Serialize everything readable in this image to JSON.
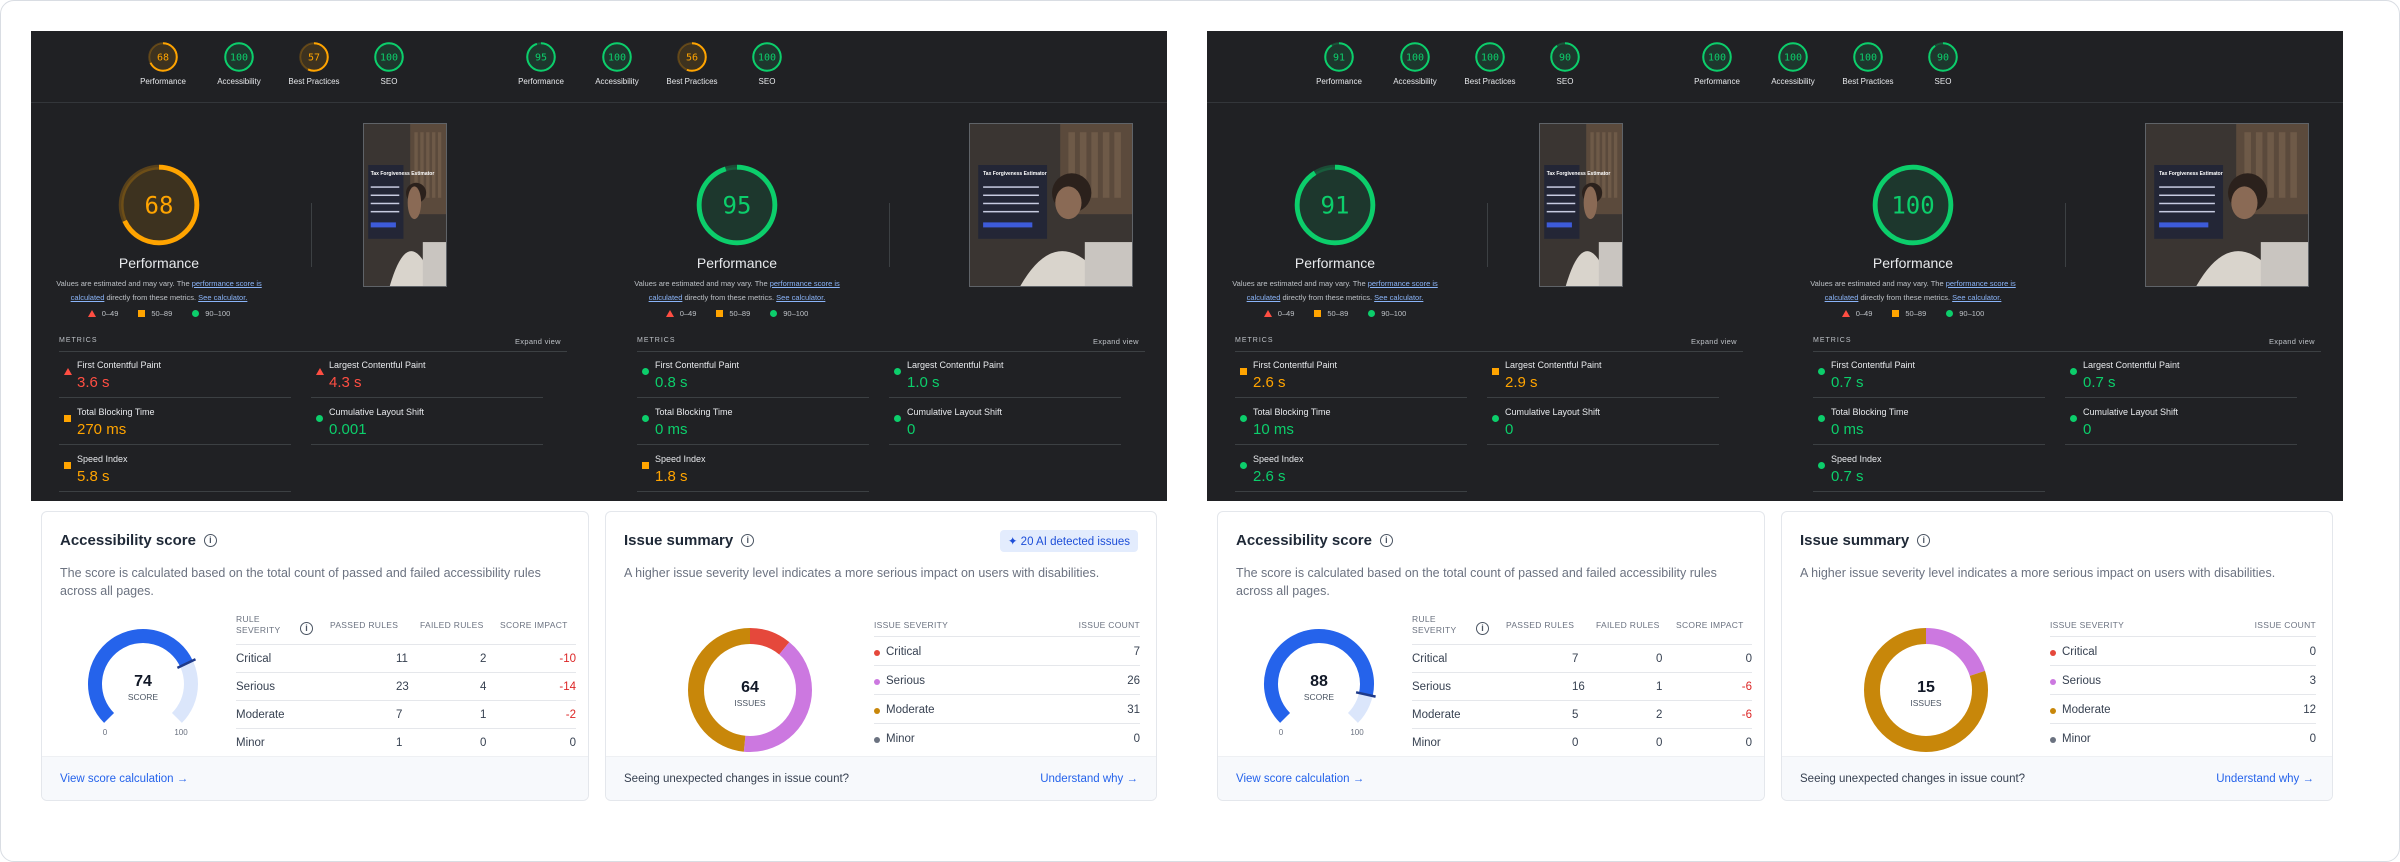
{
  "panels": [
    {
      "cats": [
        {
          "label": "Performance",
          "score": "68",
          "value": 68,
          "color": "#ffa400"
        },
        {
          "label": "Accessibility",
          "score": "100",
          "value": 100,
          "color": "#0cce6b"
        },
        {
          "label": "Best Practices",
          "score": "57",
          "value": 57,
          "color": "#ffa400"
        },
        {
          "label": "SEO",
          "score": "100",
          "value": 100,
          "color": "#0cce6b"
        },
        {
          "label": "Performance",
          "score": "95",
          "value": 95,
          "color": "#0cce6b"
        },
        {
          "label": "Accessibility",
          "score": "100",
          "value": 100,
          "color": "#0cce6b"
        },
        {
          "label": "Best Practices",
          "score": "56",
          "value": 56,
          "color": "#ffa400"
        },
        {
          "label": "SEO",
          "score": "100",
          "value": 100,
          "color": "#0cce6b"
        }
      ],
      "perf": [
        {
          "score": "68",
          "value": 68,
          "color": "#ffa400",
          "title": "Performance",
          "metrics": [
            {
              "name": "First Contentful Paint",
              "value": "3.6 s",
              "level": "red"
            },
            {
              "name": "Largest Contentful Paint",
              "value": "4.3 s",
              "level": "red"
            },
            {
              "name": "Total Blocking Time",
              "value": "270 ms",
              "level": "orange"
            },
            {
              "name": "Cumulative Layout Shift",
              "value": "0.001",
              "level": "green"
            },
            {
              "name": "Speed Index",
              "value": "5.8 s",
              "level": "orange"
            }
          ]
        },
        {
          "score": "95",
          "value": 95,
          "color": "#0cce6b",
          "title": "Performance",
          "metrics": [
            {
              "name": "First Contentful Paint",
              "value": "0.8 s",
              "level": "green"
            },
            {
              "name": "Largest Contentful Paint",
              "value": "1.0 s",
              "level": "green"
            },
            {
              "name": "Total Blocking Time",
              "value": "0 ms",
              "level": "green"
            },
            {
              "name": "Cumulative Layout Shift",
              "value": "0",
              "level": "green"
            },
            {
              "name": "Speed Index",
              "value": "1.8 s",
              "level": "orange"
            }
          ]
        }
      ],
      "accessibility": {
        "score": "74",
        "value": 74,
        "rows": [
          {
            "sev": "Critical",
            "passed": "11",
            "failed": "2",
            "impact": "-10"
          },
          {
            "sev": "Serious",
            "passed": "23",
            "failed": "4",
            "impact": "-14"
          },
          {
            "sev": "Moderate",
            "passed": "7",
            "failed": "1",
            "impact": "-2"
          },
          {
            "sev": "Minor",
            "passed": "1",
            "failed": "0",
            "impact": "0"
          }
        ]
      },
      "issues": {
        "total": "64",
        "ai_badge": "20 AI detected issues",
        "rows": [
          {
            "sev": "Critical",
            "count": "7",
            "value": 7,
            "color": "#e5483b"
          },
          {
            "sev": "Serious",
            "count": "26",
            "value": 26,
            "color": "#cc78e0"
          },
          {
            "sev": "Moderate",
            "count": "31",
            "value": 31,
            "color": "#c8870a"
          },
          {
            "sev": "Minor",
            "count": "0",
            "value": 0,
            "color": "#6b7280"
          }
        ]
      }
    },
    {
      "cats": [
        {
          "label": "Performance",
          "score": "91",
          "value": 91,
          "color": "#0cce6b"
        },
        {
          "label": "Accessibility",
          "score": "100",
          "value": 100,
          "color": "#0cce6b"
        },
        {
          "label": "Best Practices",
          "score": "100",
          "value": 100,
          "color": "#0cce6b"
        },
        {
          "label": "SEO",
          "score": "90",
          "value": 90,
          "color": "#0cce6b"
        },
        {
          "label": "Performance",
          "score": "100",
          "value": 100,
          "color": "#0cce6b"
        },
        {
          "label": "Accessibility",
          "score": "100",
          "value": 100,
          "color": "#0cce6b"
        },
        {
          "label": "Best Practices",
          "score": "100",
          "value": 100,
          "color": "#0cce6b"
        },
        {
          "label": "SEO",
          "score": "90",
          "value": 90,
          "color": "#0cce6b"
        }
      ],
      "perf": [
        {
          "score": "91",
          "value": 91,
          "color": "#0cce6b",
          "title": "Performance",
          "metrics": [
            {
              "name": "First Contentful Paint",
              "value": "2.6 s",
              "level": "orange"
            },
            {
              "name": "Largest Contentful Paint",
              "value": "2.9 s",
              "level": "orange"
            },
            {
              "name": "Total Blocking Time",
              "value": "10 ms",
              "level": "green"
            },
            {
              "name": "Cumulative Layout Shift",
              "value": "0",
              "level": "green"
            },
            {
              "name": "Speed Index",
              "value": "2.6 s",
              "level": "green"
            }
          ]
        },
        {
          "score": "100",
          "value": 100,
          "color": "#0cce6b",
          "title": "Performance",
          "metrics": [
            {
              "name": "First Contentful Paint",
              "value": "0.7 s",
              "level": "green"
            },
            {
              "name": "Largest Contentful Paint",
              "value": "0.7 s",
              "level": "green"
            },
            {
              "name": "Total Blocking Time",
              "value": "0 ms",
              "level": "green"
            },
            {
              "name": "Cumulative Layout Shift",
              "value": "0",
              "level": "green"
            },
            {
              "name": "Speed Index",
              "value": "0.7 s",
              "level": "green"
            }
          ]
        }
      ],
      "accessibility": {
        "score": "88",
        "value": 88,
        "rows": [
          {
            "sev": "Critical",
            "passed": "7",
            "failed": "0",
            "impact": "0"
          },
          {
            "sev": "Serious",
            "passed": "16",
            "failed": "1",
            "impact": "-6"
          },
          {
            "sev": "Moderate",
            "passed": "5",
            "failed": "2",
            "impact": "-6"
          },
          {
            "sev": "Minor",
            "passed": "0",
            "failed": "0",
            "impact": "0"
          }
        ]
      },
      "issues": {
        "total": "15",
        "ai_badge": "",
        "rows": [
          {
            "sev": "Critical",
            "count": "0",
            "value": 0,
            "color": "#e5483b"
          },
          {
            "sev": "Serious",
            "count": "3",
            "value": 3,
            "color": "#cc78e0"
          },
          {
            "sev": "Moderate",
            "count": "12",
            "value": 12,
            "color": "#c8870a"
          },
          {
            "sev": "Minor",
            "count": "0",
            "value": 0,
            "color": "#6b7280"
          }
        ]
      }
    }
  ],
  "text": {
    "note_a": "Values are estimated and may vary. The ",
    "note_link1": "performance score is calculated",
    "note_b": " directly from these metrics. ",
    "note_link2": "See calculator.",
    "legend_bad": "0–49",
    "legend_avg": "50–89",
    "legend_good": "90–100",
    "metrics": "METRICS",
    "expand": "Expand view",
    "shot_title": "Tax Forgiveness Estimator",
    "acc_title": "Accessibility score",
    "acc_desc": "The score is calculated based on the total count of passed and failed accessibility rules across all pages.",
    "score_label": "SCORE",
    "min": "0",
    "max": "100",
    "col_sev": "RULE SEVERITY",
    "col_passed": "PASSED RULES",
    "col_failed": "FAILED RULES",
    "col_impact": "SCORE IMPACT",
    "view_calc": "View score calculation →",
    "iss_title": "Issue summary",
    "iss_desc": "A higher issue severity level indicates a more serious impact on users with disabilities.",
    "issues_label": "ISSUES",
    "col_iss_sev": "ISSUE SEVERITY",
    "col_iss_count": "ISSUE COUNT",
    "unexpected": "Seeing unexpected changes in issue count?",
    "understand": "Understand why →"
  },
  "colors": {
    "bad": "#ff4e42",
    "average": "#ffa400",
    "good": "#0cce6b",
    "accent": "#2563eb"
  }
}
